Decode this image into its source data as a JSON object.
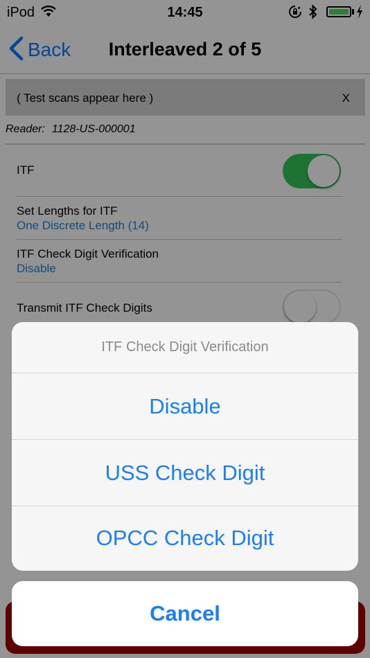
{
  "status_bar": {
    "carrier": "iPod",
    "time": "14:45",
    "battery_level": 1.0,
    "battery_color": "#4cd964"
  },
  "nav": {
    "back_label": "Back",
    "title": "Interleaved 2 of 5"
  },
  "scan_banner": {
    "text": "( Test scans appear here )",
    "close_label": "X"
  },
  "reader": {
    "label": "Reader:",
    "id": "1128-US-000001"
  },
  "settings": {
    "itf": {
      "label": "ITF",
      "enabled": true
    },
    "set_lengths": {
      "label": "Set Lengths for ITF",
      "value": "One Discrete Length (14)"
    },
    "check_digit": {
      "label": "ITF Check Digit Verification",
      "value": "Disable"
    },
    "transmit": {
      "label": "Transmit ITF Check Digits",
      "enabled": false
    }
  },
  "action_sheet": {
    "title": "ITF Check Digit Verification",
    "options": [
      "Disable",
      "USS Check Digit",
      "OPCC Check Digit"
    ],
    "cancel_label": "Cancel"
  },
  "colors": {
    "accent": "#1a7ff0",
    "toggle_on": "#34c759",
    "link_value": "#1c86d6",
    "bottom_button": "#a40000"
  }
}
